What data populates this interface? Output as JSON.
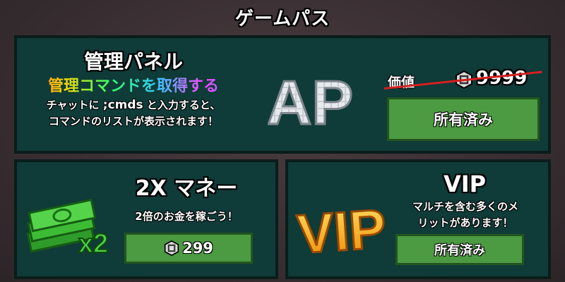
{
  "header": {
    "title": "ゲームパス"
  },
  "admin_pass": {
    "name": "管理パネル",
    "subtitle": "管理コマンドを取得する",
    "desc_prefix": "チャットに ",
    "desc_command": ";cmds",
    "desc_suffix": " と入力すると、",
    "desc_line2": "コマンドのリストが表示されます！",
    "logo_text": "AP",
    "price_label": "価値",
    "price_icon": "robux-icon",
    "price_value": "9999",
    "button_label": "所有済み"
  },
  "money_pass": {
    "name": "2X マネー",
    "desc": "2倍のお金を稼ごう！",
    "image_label": "x2",
    "price_icon": "robux-icon",
    "price_value": "299"
  },
  "vip_pass": {
    "name": "VIP",
    "desc_line1": "マルチを含む多くのメ",
    "desc_line2": "リットがあります！",
    "logo_text": "VIP",
    "button_label": "所有済み"
  },
  "colors": {
    "panel_bg": "#0f3b38",
    "button_green": "#4c9a42",
    "strike_red": "#d42020"
  }
}
